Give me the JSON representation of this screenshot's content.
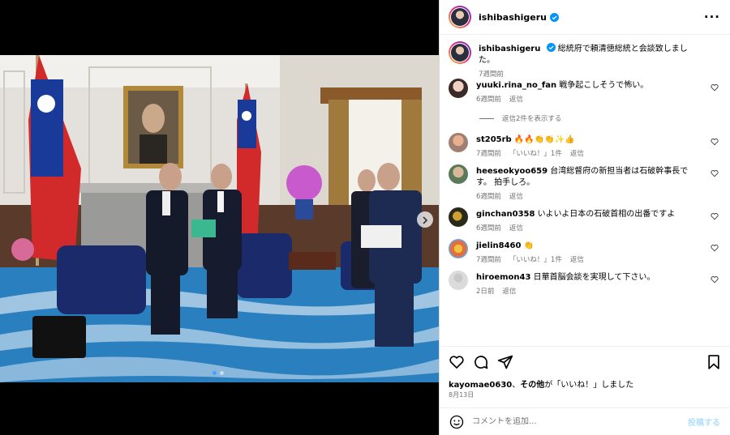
{
  "post": {
    "username": "ishibashigeru",
    "caption": "総統府で頼清徳総統と会談致しました。",
    "caption_time": "7週間前"
  },
  "comments": [
    {
      "user": "yuuki.rina_no_fan",
      "text": "戦争起こしそうで怖い。",
      "time": "6週間前",
      "reply": "返信"
    },
    {
      "user": "st205rb",
      "text": "🔥🔥👏👏✨👍",
      "time": "7週間前",
      "likes": "「いいね！」1件",
      "reply": "返信"
    },
    {
      "user": "heeseokyoo659",
      "text": "台湾総督府の新担当者は石破幹事長です。 拍手しろ。",
      "time": "6週間前",
      "reply": "返信"
    },
    {
      "user": "ginchan0358",
      "text": "いよいよ日本の石破首相の出番ですよ",
      "time": "6週間前",
      "reply": "返信"
    },
    {
      "user": "jielin8460",
      "text": "👏",
      "time": "7週間前",
      "likes": "「いいね！」1件",
      "reply": "返信"
    },
    {
      "user": "hiroemon43",
      "text": "日華首脳会談を実現して下さい。",
      "time": "2日前",
      "reply": "返信"
    }
  ],
  "view_replies": "返信2件を表示する",
  "likes": {
    "user": "kayomae0630",
    "sep": "、",
    "others": "その他",
    "suffix": "が「いいね！」しました"
  },
  "date": "8月13日",
  "add_comment": {
    "placeholder": "コメントを追加...",
    "post_label": "投稿する"
  },
  "icons": {
    "more": "more-options-icon",
    "heart": "heart-icon",
    "comment": "comment-icon",
    "share": "share-icon",
    "save": "bookmark-icon",
    "emoji": "emoji-icon",
    "next": "chevron-right-icon"
  }
}
